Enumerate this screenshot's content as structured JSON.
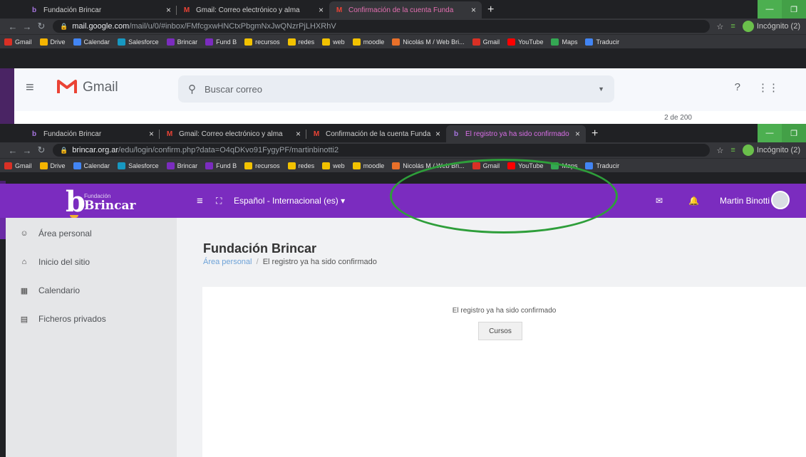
{
  "win1": {
    "tabs": [
      {
        "icon": "b",
        "title": "Fundación Brincar"
      },
      {
        "icon": "M",
        "title": "Gmail: Correo electrónico y alma"
      },
      {
        "icon": "M",
        "title": "Confirmación de la cuenta Funda"
      }
    ],
    "url_host": "mail.google.com",
    "url_path": "/mail/u/0/#inbox/FMfcgxwHNCtxPbgmNxJwQNzrPjLHXRhV",
    "incognito": "Incógnito (2)",
    "gmail_word": "Gmail",
    "search_placeholder": "Buscar correo",
    "pagination": "2 de 200"
  },
  "win2": {
    "tabs": [
      {
        "icon": "b",
        "title": "Fundación Brincar"
      },
      {
        "icon": "M",
        "title": "Gmail: Correo electrónico y alma"
      },
      {
        "icon": "M",
        "title": "Confirmación de la cuenta Funda"
      },
      {
        "icon": "b",
        "title": "El registro ya ha sido confirmado"
      }
    ],
    "url_host": "brincar.org.ar",
    "url_path": "/edu/login/confirm.php?data=O4qDKvo91FygyPF/martinbinotti2",
    "incognito": "Incógnito (2)"
  },
  "bookmarks": [
    {
      "label": "Gmail",
      "color": "#d93025"
    },
    {
      "label": "Drive",
      "color": "#f4b400"
    },
    {
      "label": "Calendar",
      "color": "#4285f4"
    },
    {
      "label": "Salesforce",
      "color": "#1798c1"
    },
    {
      "label": "Brincar",
      "color": "#7b2cbf"
    },
    {
      "label": "Fund B",
      "color": "#7b2cbf"
    },
    {
      "label": "recursos",
      "color": "#f2c200"
    },
    {
      "label": "redes",
      "color": "#f2c200"
    },
    {
      "label": "web",
      "color": "#f2c200"
    },
    {
      "label": "moodle",
      "color": "#f2c200"
    },
    {
      "label": "Nicolás M / Web Bri...",
      "color": "#e8702a"
    },
    {
      "label": "Gmail",
      "color": "#d93025"
    },
    {
      "label": "YouTube",
      "color": "#ff0000"
    },
    {
      "label": "Maps",
      "color": "#34a853"
    },
    {
      "label": "Traducir",
      "color": "#4285f4"
    }
  ],
  "site": {
    "logo_small": "Fundación",
    "logo_name": "Brincar",
    "language": "Español - Internacional (es)",
    "user": "Martin Binotti",
    "sidebar": [
      {
        "icon": "☺",
        "label": "Área personal"
      },
      {
        "icon": "⌂",
        "label": "Inicio del sitio"
      },
      {
        "icon": "▦",
        "label": "Calendario"
      },
      {
        "icon": "▤",
        "label": "Ficheros privados"
      }
    ],
    "page_title": "Fundación Brincar",
    "crumb_link": "Área personal",
    "crumb_sep": "/",
    "crumb_current": "El registro ya ha sido confirmado",
    "notice": "El registro ya ha sido confirmado",
    "button": "Cursos"
  },
  "colors": {
    "brand": "#7b2cbf",
    "highlight": "#2e9e3a"
  }
}
